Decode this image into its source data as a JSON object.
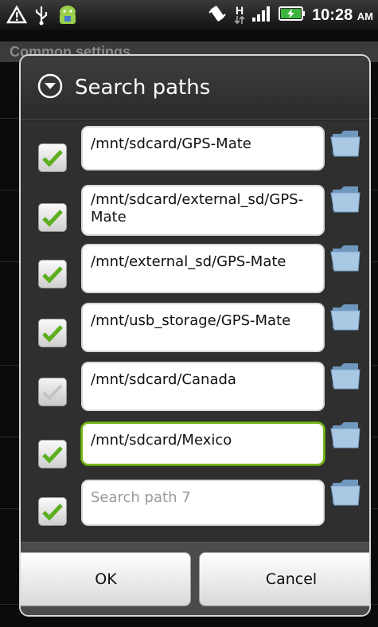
{
  "statusbar": {
    "time": "10:28",
    "ampm": "AM",
    "network_letter": "H",
    "icons": [
      "warning-icon",
      "usb-icon",
      "android-icon",
      "vibrate-icon",
      "network-type-icon",
      "signal-icon",
      "battery-charging-icon"
    ]
  },
  "background": {
    "section_header": "Common settings"
  },
  "dialog": {
    "title": "Search paths",
    "title_icon": "collapse-circle-icon",
    "rows": [
      {
        "path": "/mnt/sdcard/GPS-Mate",
        "checked": true
      },
      {
        "path": "/mnt/sdcard/external_sd/GPS-Mate",
        "checked": true
      },
      {
        "path": "/mnt/external_sd/GPS-Mate",
        "checked": true
      },
      {
        "path": "/mnt/usb_storage/GPS-Mate",
        "checked": true
      },
      {
        "path": "/mnt/sdcard/Canada",
        "checked": false
      },
      {
        "path": "/mnt/sdcard/Mexico",
        "checked": true,
        "focused": true
      },
      {
        "path": "",
        "placeholder": "Search path 7",
        "checked": true
      }
    ],
    "ok_label": "OK",
    "cancel_label": "Cancel"
  },
  "colors": {
    "check_green": "#5cae1e",
    "focus_green": "#7ab81a",
    "folder_blue": "#8fb6d8"
  }
}
